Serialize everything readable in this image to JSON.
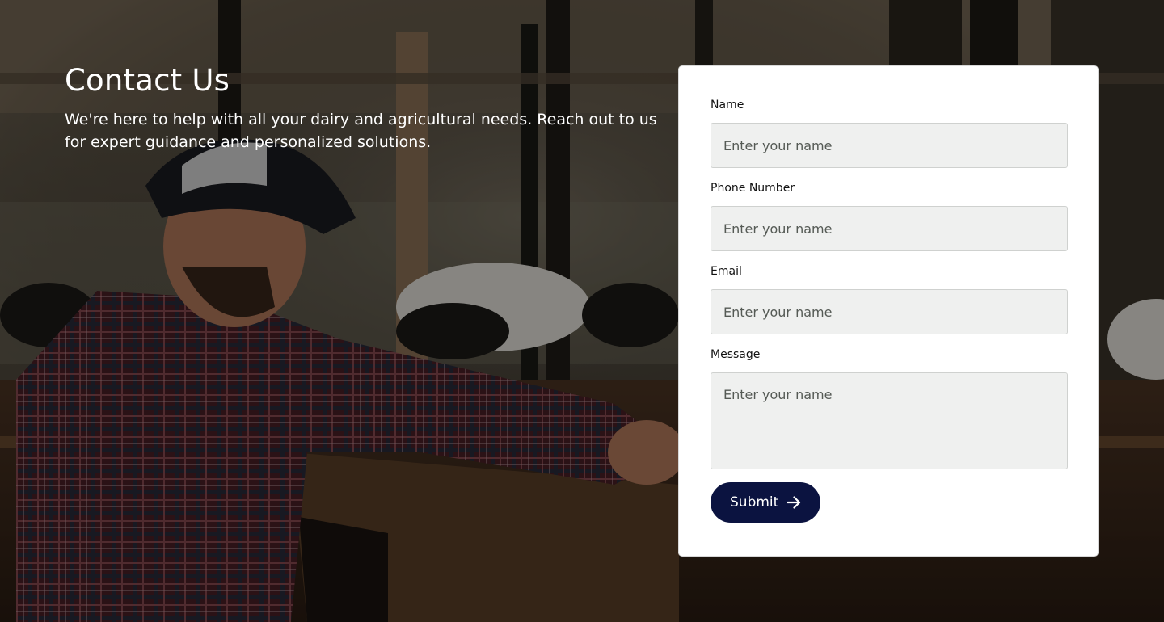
{
  "hero": {
    "title": "Contact Us",
    "subtitle": "We're here to help with all your dairy and agricultural needs. Reach out to us for expert guidance and personalized solutions."
  },
  "form": {
    "name": {
      "label": "Name",
      "placeholder": "Enter your name",
      "value": ""
    },
    "phone": {
      "label": "Phone Number",
      "placeholder": "Enter your name",
      "value": ""
    },
    "email": {
      "label": "Email",
      "placeholder": "Enter your name",
      "value": ""
    },
    "message": {
      "label": "Message",
      "placeholder": "Enter your name",
      "value": ""
    },
    "submit_label": "Submit",
    "submit_icon": "arrow-right-icon"
  },
  "colors": {
    "button_bg": "#0b1340",
    "input_bg": "#eff0ef",
    "card_bg": "#ffffff",
    "text_light": "#ffffff"
  }
}
